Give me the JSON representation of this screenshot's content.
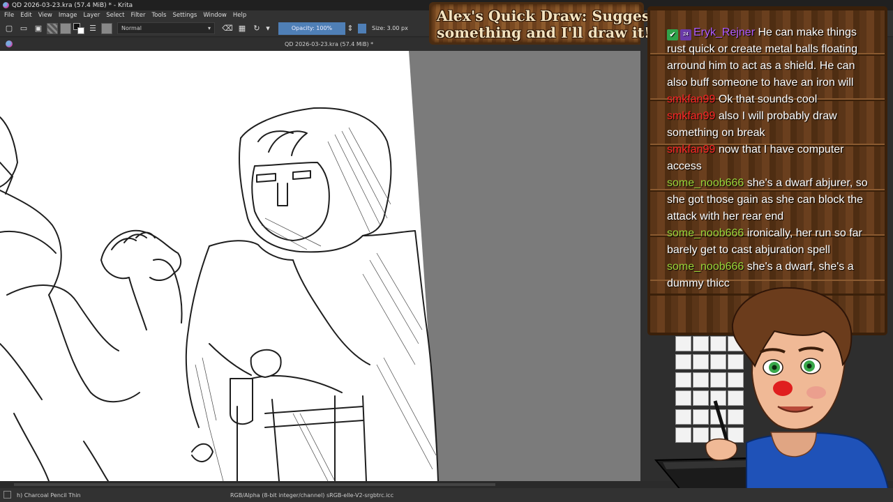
{
  "window": {
    "title": "QD 2026-03-23.kra (57.4 MiB) * - Krita"
  },
  "menu": [
    "File",
    "Edit",
    "View",
    "Image",
    "Layer",
    "Select",
    "Filter",
    "Tools",
    "Settings",
    "Window",
    "Help"
  ],
  "toolbar": {
    "blend_mode": "Normal",
    "opacity_label": "Opacity: 100%",
    "size_label": "Size: 3.00 px"
  },
  "document": {
    "tab_title": "QD 2026-03-23.kra (57.4 MiB) *"
  },
  "status": {
    "brush": "h) Charcoal Pencil Thin",
    "color_profile": "RGB/Alpha (8-bit integer/channel)  sRGB-elle-V2-srgbtrc.icc"
  },
  "overlay": {
    "sign_line1": "Alex's Quick Draw: Suggest",
    "sign_line2": "something and I'll draw it!"
  },
  "chat": {
    "messages": [
      {
        "user": "Eryk_Rejner",
        "color": "#b05cff",
        "badges": [
          "✔",
          "24"
        ],
        "text": "He can make things rust quick or create metal balls floating arround him to act as a shield. He can also buff someone to have an iron will"
      },
      {
        "user": "smkfan99",
        "color": "#ff2626",
        "text": "Ok that sounds cool"
      },
      {
        "user": "smkfan99",
        "color": "#ff2626",
        "text": "also I will probably draw something on break"
      },
      {
        "user": "smkfan99",
        "color": "#ff2626",
        "text": "now that I have computer access"
      },
      {
        "user": "some_noob666",
        "color": "#9bd63a",
        "text": "she's a dwarf abjurer, so she got those gain as she can block the attack with her rear end"
      },
      {
        "user": "some_noob666",
        "color": "#9bd63a",
        "text": "ironically, her run so far barely get to cast abjuration spell"
      },
      {
        "user": "some_noob666",
        "color": "#9bd63a",
        "text": "she's a dwarf, she's a dummy thicc"
      }
    ]
  }
}
